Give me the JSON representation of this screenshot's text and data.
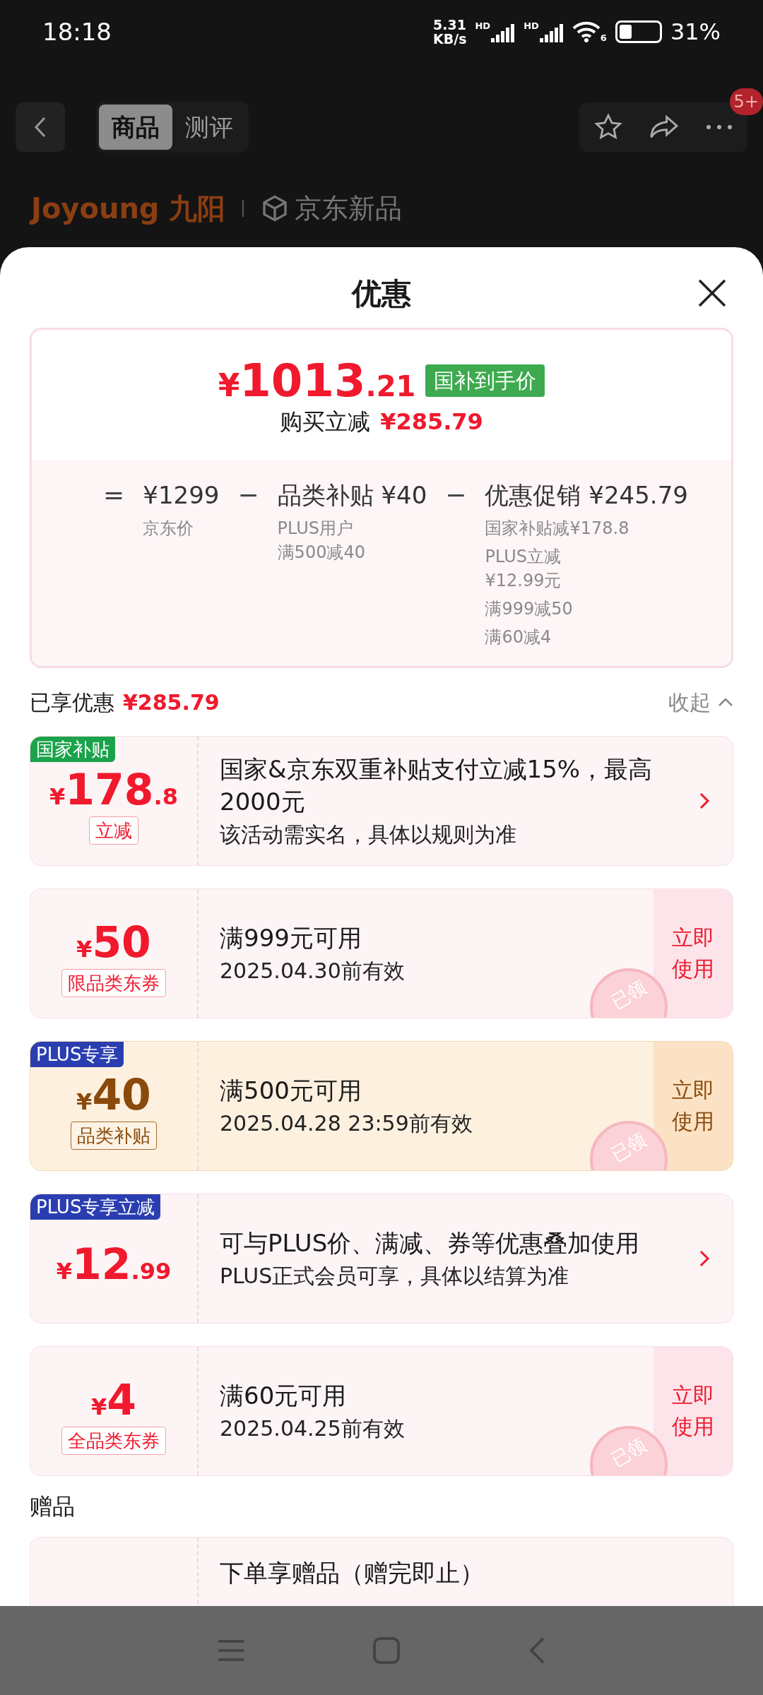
{
  "status_bar": {
    "time": "18:18",
    "speed_value": "5.31",
    "speed_unit": "KB/s",
    "signal_labels": [
      "HD",
      "HD"
    ],
    "wifi_label": "6",
    "battery_text": "31%"
  },
  "header": {
    "tabs": [
      {
        "label": "商品",
        "selected": true
      },
      {
        "label": "测评",
        "selected": false
      }
    ],
    "badge": "5+"
  },
  "brand": {
    "logo": "Joyoung 九阳",
    "tag": "京东新品"
  },
  "sheet": {
    "title": "优惠"
  },
  "price_card": {
    "currency": "¥",
    "price_int": "1013",
    "price_dec": ".21",
    "badge": "国补到手价",
    "reduce_label": "购买立减",
    "reduce_value": "¥285.79",
    "breakdown": [
      {
        "op": "=",
        "head": "¥1299",
        "notes": [
          {
            "lines": [
              "京东价"
            ]
          }
        ]
      },
      {
        "op": "−",
        "head": "品类补贴 ¥40",
        "notes": [
          {
            "lines": [
              "PLUS用户",
              "满500减40"
            ]
          }
        ]
      },
      {
        "op": "−",
        "head": "优惠促销 ¥245.79",
        "notes": [
          {
            "lines": [
              "国家补贴减¥178.8"
            ]
          },
          {
            "lines": [
              "PLUS立减",
              "¥12.99元"
            ]
          },
          {
            "lines": [
              "满999减50"
            ]
          },
          {
            "lines": [
              "满60减4"
            ]
          }
        ]
      }
    ]
  },
  "summary": {
    "label": "已享优惠",
    "value": "¥285.79",
    "toggle": "收起"
  },
  "coupons": [
    {
      "kind": "subsidy",
      "highlighted": false,
      "tag": "国家补贴",
      "color": "#1aa34a",
      "currency": "¥",
      "amount_int": "178",
      "amount_dec": ".8",
      "label": "立减",
      "title": "国家&京东双重补贴支付立减15%，最高2000元",
      "subtitle": "该活动需实名，具体以规则为准"
    },
    {
      "kind": "coupon",
      "highlighted": false,
      "currency": "¥",
      "amount_int": "50",
      "label": "限品类东券",
      "title": "满999元可用",
      "subtitle": "2025.04.30前有效",
      "action": "立即使用",
      "stamp": "已领"
    },
    {
      "kind": "coupon",
      "highlighted": true,
      "tag": "PLUS专享",
      "color": "#2a3eb1",
      "currency": "¥",
      "amount_int": "40",
      "label": "品类补贴",
      "title": "满500元可用",
      "subtitle": "2025.04.28 23:59前有效",
      "action": "立即使用",
      "stamp": "已领"
    },
    {
      "kind": "subsidy",
      "highlighted": false,
      "tag": "PLUS专享立减",
      "color": "#2a3eb1",
      "currency": "¥",
      "amount_int": "12",
      "amount_dec": ".99",
      "title": "可与PLUS价、满减、券等优惠叠加使用",
      "subtitle": "PLUS正式会员可享，具体以结算为准"
    },
    {
      "kind": "coupon",
      "highlighted": false,
      "currency": "¥",
      "amount_int": "4",
      "label": "全品类东券",
      "title": "满60元可用",
      "subtitle": "2025.04.25前有效",
      "action": "立即使用",
      "stamp": "已领"
    }
  ],
  "gifts": {
    "heading": "赠品",
    "items": [
      {
        "title": "下单享赠品（赠完即止）"
      }
    ]
  }
}
